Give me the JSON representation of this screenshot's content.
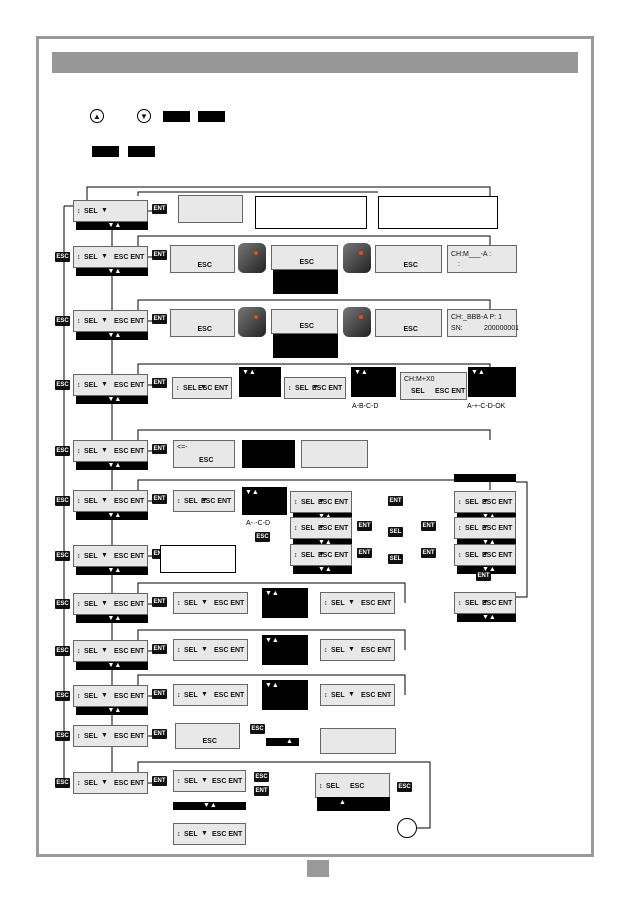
{
  "labels": {
    "sel": "SEL",
    "sel_icon": "↕",
    "esc_ent": "ESC ENT",
    "esc": "ESC",
    "ent": "ENT",
    "nav": "▼▲",
    "up": "▲",
    "down": "▼",
    "back": "<=-",
    "ok": "OK"
  },
  "screens": {
    "channel_edit": "CH:M___-A   :",
    "channel_edit_2": ":",
    "channel_info": "CH:_BBB-A  P:  1",
    "serial_label": "SN:",
    "serial_value": "200000001",
    "channel_code": "CH:M+X0"
  },
  "sequences": {
    "abcd": "A-B-C-D",
    "a_cd_ok": "A-+-C-D-OK",
    "acd": "A-·-C-D"
  },
  "icons": [
    "up-arrow-button-icon",
    "down-arrow-button-icon",
    "remote-control-icon",
    "clock-icon"
  ],
  "colors": {
    "frame": "#9a9a9a",
    "screen": "#e8e8e8",
    "tag": "#111111"
  }
}
